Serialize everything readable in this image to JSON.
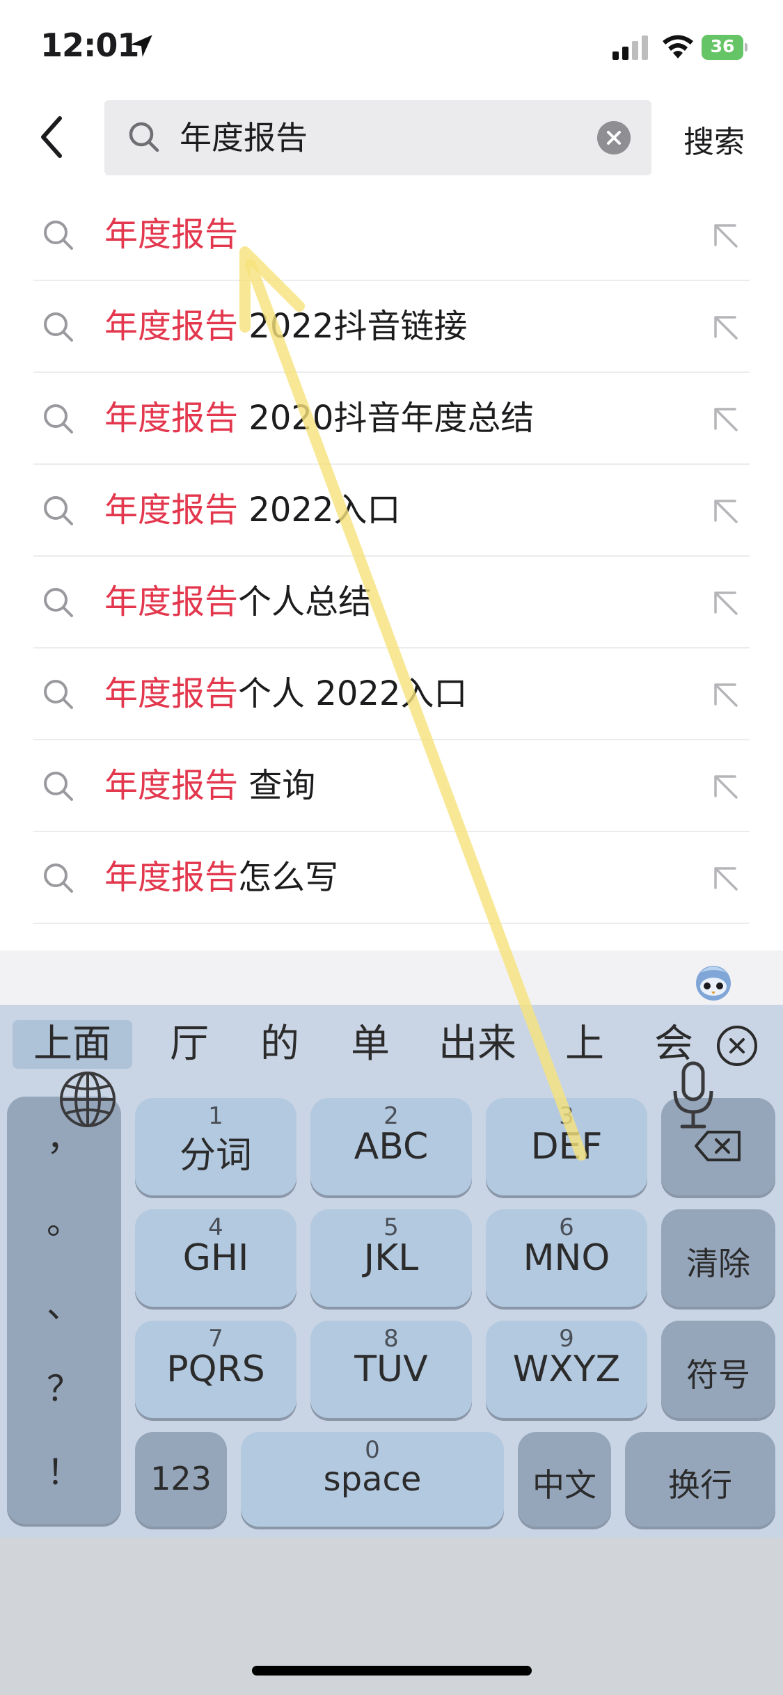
{
  "status_bar": {
    "time": "12:01",
    "battery": "36"
  },
  "header": {
    "search_query": "年度报告",
    "search_button": "搜索"
  },
  "suggestions": [
    {
      "highlight": "年度报告",
      "rest": ""
    },
    {
      "highlight": "年度报告",
      "rest": " 2022抖音链接"
    },
    {
      "highlight": "年度报告",
      "rest": " 2020抖音年度总结"
    },
    {
      "highlight": "年度报告",
      "rest": " 2022入口"
    },
    {
      "highlight": "年度报告",
      "rest": "个人总结"
    },
    {
      "highlight": "年度报告",
      "rest": "个人 2022入口"
    },
    {
      "highlight": "年度报告",
      "rest": " 查询"
    },
    {
      "highlight": "年度报告",
      "rest": "怎么写"
    }
  ],
  "keyboard": {
    "candidates": [
      "上面",
      "厅",
      "的",
      "单",
      "出来",
      "上",
      "会"
    ],
    "punctuation": [
      "，",
      "。",
      "、",
      "？",
      "！"
    ],
    "keys": {
      "k1": {
        "num": "1",
        "label": "分词"
      },
      "k2": {
        "num": "2",
        "label": "ABC"
      },
      "k3": {
        "num": "3",
        "label": "DEF"
      },
      "k4": {
        "num": "4",
        "label": "GHI"
      },
      "k5": {
        "num": "5",
        "label": "JKL"
      },
      "k6": {
        "num": "6",
        "label": "MNO"
      },
      "k7": {
        "num": "7",
        "label": "PQRS"
      },
      "k8": {
        "num": "8",
        "label": "TUV"
      },
      "k9": {
        "num": "9",
        "label": "WXYZ"
      },
      "k0": {
        "num": "0",
        "label": "space"
      },
      "clear": "清除",
      "symbols": "符号",
      "numeric": "123",
      "chinese": "中文",
      "return": "换行"
    }
  },
  "colors": {
    "highlight": "#e3374d",
    "key_light": "#b3c9e0",
    "key_dark": "#95a6bb",
    "annotation_arrow": "#f6e27a"
  }
}
